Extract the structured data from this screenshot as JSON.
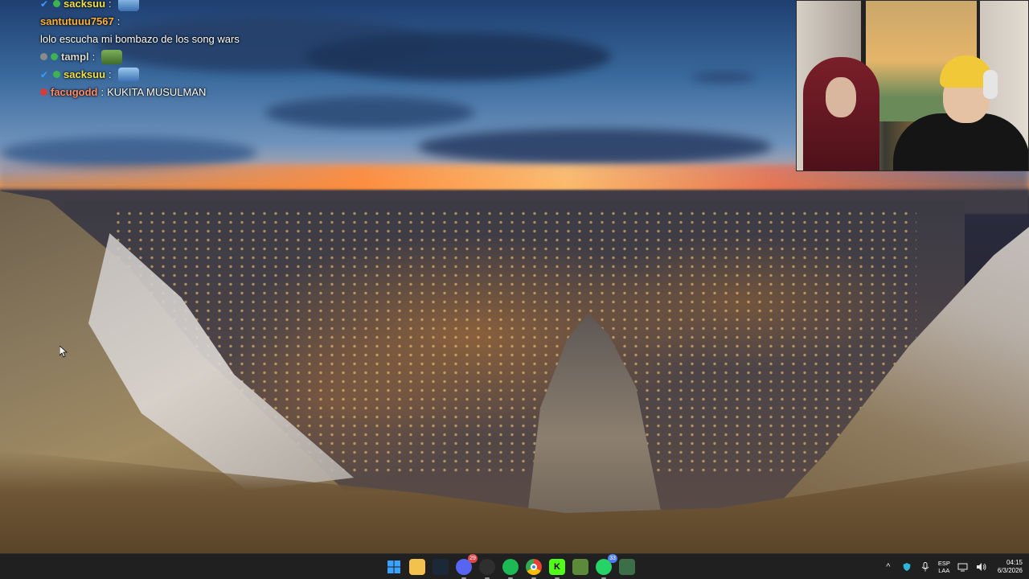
{
  "chat": {
    "messages": [
      {
        "user": "sacksuu",
        "text": "",
        "badges": [
          "verified",
          "green"
        ],
        "emote": "e2"
      },
      {
        "user": "santutuuu7567",
        "text": "lolo escucha mi bombazo de los song wars",
        "badges": [],
        "emote": null
      },
      {
        "user": "tampl",
        "text": "",
        "badges": [
          "grey",
          "green"
        ],
        "emote": "e3"
      },
      {
        "user": "sacksuu",
        "text": "",
        "badges": [
          "verified",
          "green"
        ],
        "emote": "e2"
      },
      {
        "user": "facugodd",
        "text": "KUKITA MUSULMAN",
        "badges": [
          "red"
        ],
        "emote": null
      }
    ],
    "user_colors": {
      "sacksuu": "#f2e14a",
      "santutuuu7567": "#ffb13b",
      "tampl": "#d9d9d9",
      "facugodd": "#ff8a6a"
    }
  },
  "taskbar": {
    "apps": [
      {
        "name": "windows-start",
        "icon": "windows-logo-icon",
        "glyph": "",
        "color": "#3aa3ff",
        "running": false,
        "badge": ""
      },
      {
        "name": "file-explorer",
        "icon": "folder-icon",
        "glyph": "",
        "color": "#f2c14e",
        "running": false,
        "badge": ""
      },
      {
        "name": "steam",
        "icon": "steam-icon",
        "glyph": "",
        "color": "#1b2838",
        "running": false,
        "badge": ""
      },
      {
        "name": "discord",
        "icon": "discord-icon",
        "glyph": "",
        "color": "#5865f2",
        "running": true,
        "badge": "29"
      },
      {
        "name": "obs",
        "icon": "obs-icon",
        "glyph": "",
        "color": "#2f2f2f",
        "running": true,
        "badge": ""
      },
      {
        "name": "spotify",
        "icon": "spotify-icon",
        "glyph": "",
        "color": "#1db954",
        "running": true,
        "badge": ""
      },
      {
        "name": "chrome",
        "icon": "chrome-icon",
        "glyph": "",
        "color": "#ea4335",
        "running": true,
        "badge": ""
      },
      {
        "name": "kick",
        "icon": "kick-icon",
        "glyph": "K",
        "color": "#53fc18",
        "running": true,
        "badge": ""
      },
      {
        "name": "minecraft",
        "icon": "minecraft-icon",
        "glyph": "",
        "color": "#5b8a3a",
        "running": false,
        "badge": ""
      },
      {
        "name": "whatsapp",
        "icon": "whatsapp-icon",
        "glyph": "",
        "color": "#25d366",
        "running": true,
        "badge": "33"
      },
      {
        "name": "app-extra",
        "icon": "spreadsheet-icon",
        "glyph": "",
        "color": "#3c6e47",
        "running": false,
        "badge": ""
      }
    ],
    "tray": {
      "chevron": "^",
      "lang_top": "ESP",
      "lang_bottom": "LAA",
      "time": "04:15",
      "date": "6/3/2026"
    }
  }
}
